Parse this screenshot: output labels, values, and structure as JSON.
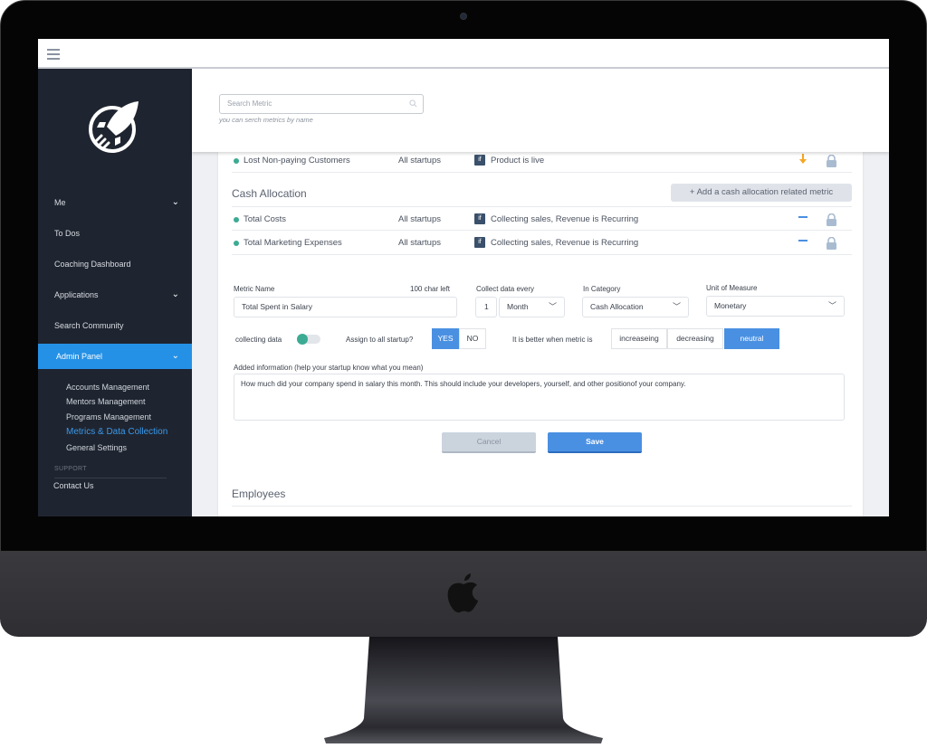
{
  "device": {
    "type": "imac",
    "brand_icon": "apple-logo-icon"
  },
  "topbar": {
    "menu_icon": "hamburger-icon"
  },
  "sidebar": {
    "logo_icon": "rocket-logo-icon",
    "items": [
      {
        "label": "Me",
        "has_chevron": true
      },
      {
        "label": "To Dos",
        "has_chevron": false
      },
      {
        "label": "Coaching Dashboard",
        "has_chevron": false
      },
      {
        "label": "Applications",
        "has_chevron": true
      },
      {
        "label": "Search Community",
        "has_chevron": false
      },
      {
        "label": "Admin Panel",
        "has_chevron": true,
        "active": true
      }
    ],
    "chevron": "❯",
    "sub_items": [
      {
        "label": "Accounts Management"
      },
      {
        "label": "Mentors Management"
      },
      {
        "label": "Programs Management"
      },
      {
        "label": "Metrics & Data Collection",
        "active": true
      },
      {
        "label": "General Settings"
      }
    ],
    "support_label": "SUPPORT",
    "contact_label": "Contact Us"
  },
  "search": {
    "placeholder": "Search Metric",
    "hint": "you can serch metrics by name"
  },
  "metrics": {
    "top_row": {
      "name": "Lost Non-paying Customers",
      "scope": "All startups",
      "if": "if",
      "condition": "Product is live",
      "trend": "down",
      "locked": true
    },
    "cash_allocation": {
      "title": "Cash Allocation",
      "add_label": "+  Add a cash allocation related metric",
      "rows": [
        {
          "name": "Total Costs",
          "scope": "All startups",
          "if": "if",
          "condition": "Collecting sales,  Revenue is Recurring",
          "trend": "neutral",
          "locked": true
        },
        {
          "name": "Total Marketing Expenses",
          "scope": "All startups",
          "if": "if",
          "condition": "Collecting sales,  Revenue is Recurring",
          "trend": "neutral",
          "locked": true
        }
      ]
    },
    "employees": {
      "title": "Employees"
    }
  },
  "form": {
    "metric_name_label": "Metric Name",
    "char_left": "100 char left",
    "metric_name_value": "Total Spent in Salary",
    "collect_label": "Collect data every",
    "collect_count": "1",
    "collect_period": "Month",
    "category_label": "In Category",
    "category_value": "Cash Allocation",
    "unit_label": "Unit of Measure",
    "unit_value": "Monetary",
    "collecting_label": "collecting data",
    "collecting_on": true,
    "assign_label": "Assign to all startup?",
    "assign_yes": "YES",
    "assign_no": "NO",
    "assign_selected": "YES",
    "better_label": "It is better when metric is",
    "better_options": [
      "increaseing",
      "decreasing",
      "neutral"
    ],
    "better_selected": "neutral",
    "info_label": "Added information (help your startup know what you mean)",
    "info_value": "How much did your company spend in salary this month. This should include your developers, yourself, and other positionof your company.",
    "cancel_label": "Cancel",
    "save_label": "Save"
  },
  "colors": {
    "accent": "#2591e6",
    "sidebar_bg": "#1f2530",
    "status_dot": "#3bab93",
    "trend_down": "#f5a623",
    "trend_neutral": "#4a90e2",
    "lock": "#a9bbd0"
  }
}
